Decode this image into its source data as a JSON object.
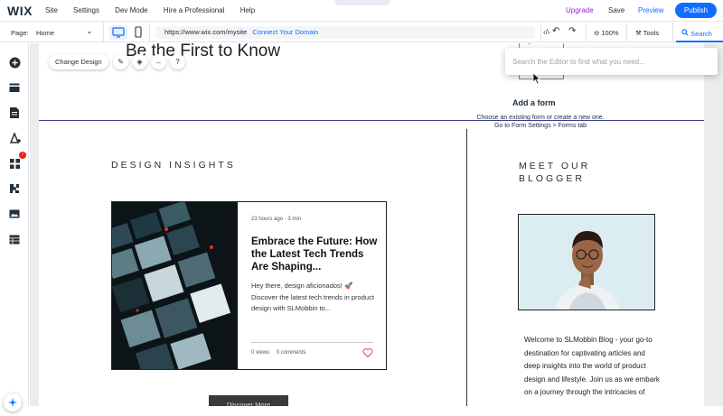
{
  "topbar": {
    "logo": "WIX",
    "menu": [
      "Site",
      "Settings",
      "Dev Mode",
      "Hire a Professional",
      "Help"
    ],
    "upgrade": "Upgrade",
    "save": "Save",
    "preview": "Preview",
    "publish": "Publish"
  },
  "secondbar": {
    "page_label": "Page:",
    "page_name": "Home",
    "url": "https://www.wix.com/mysite",
    "connect_domain": "Connect Your Domain",
    "zoom": "100%",
    "tools": "Tools",
    "search": "Search"
  },
  "search_panel": {
    "placeholder": "Search the Editor to find what you need..."
  },
  "canvas": {
    "heading_top": "Be the First to Know",
    "toolbar": {
      "change_design": "Change Design"
    },
    "add_form": {
      "title": "Add a form",
      "desc_line1": "Choose an existing form or create a new one.",
      "desc_line2": "Go to Form Settings > Forms tab"
    },
    "design_insights": "DESIGN INSIGHTS",
    "post": {
      "time": "23 hours ago",
      "read": "3 min",
      "title": "Embrace the Future: How the Latest Tech Trends Are Shaping...",
      "excerpt": "Hey there, design aficionados! 🚀 Discover the latest tech trends in product design with SLMobbin to...",
      "views": "0 views",
      "comments": "0 comments"
    },
    "discover_more": "Discover More",
    "blogger_title_line1": "MEET OUR",
    "blogger_title_line2": "BLOGGER",
    "blogger_text": "Welcome to SLMobbin Blog - your go-to destination for captivating articles and deep insights into the world of product design and lifestyle. Join us as we embark on a journey through the intricacies of"
  },
  "leftbar": {
    "badge": "!"
  }
}
